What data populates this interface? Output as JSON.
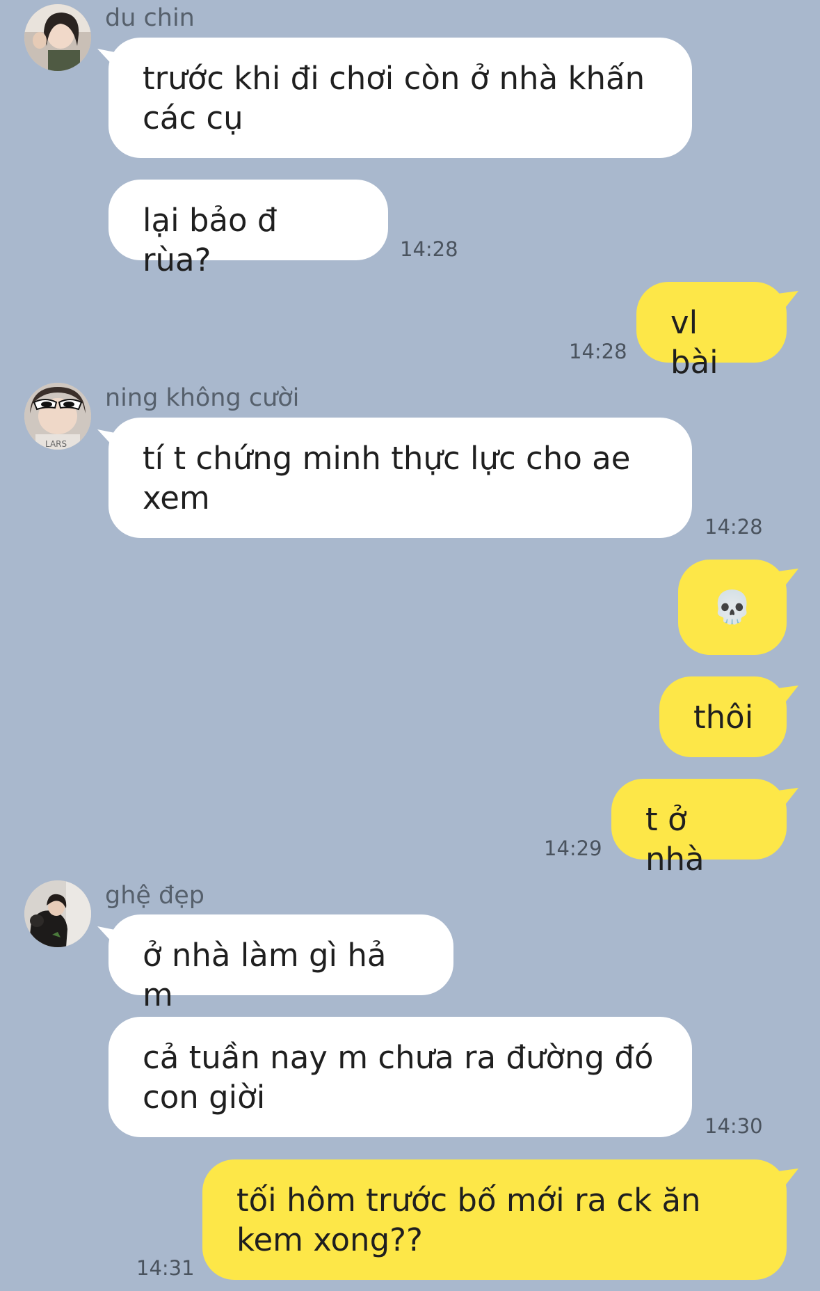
{
  "colors": {
    "background": "#a9b8cd",
    "incoming_bubble": "#ffffff",
    "outgoing_bubble": "#fde748",
    "timestamp": "#4a535e",
    "sender_name": "#56606c"
  },
  "messages": [
    {
      "id": 1,
      "sender": "du chin",
      "direction": "incoming",
      "text": "trước khi đi chơi còn ở nhà khấn các cụ"
    },
    {
      "id": 2,
      "sender": "du chin",
      "direction": "incoming",
      "text": "lại bảo đ rùa?",
      "time": "14:28"
    },
    {
      "id": 3,
      "sender": "me",
      "direction": "outgoing",
      "text": "vl bài",
      "time": "14:28"
    },
    {
      "id": 4,
      "sender": "ning không cười",
      "direction": "incoming",
      "text": "tí t chứng minh thực lực cho ae xem",
      "time": "14:28"
    },
    {
      "id": 5,
      "sender": "me",
      "direction": "outgoing",
      "text": "💀",
      "icon": "skull-emoji"
    },
    {
      "id": 6,
      "sender": "me",
      "direction": "outgoing",
      "text": "thôi"
    },
    {
      "id": 7,
      "sender": "me",
      "direction": "outgoing",
      "text": "t ở nhà",
      "time": "14:29"
    },
    {
      "id": 8,
      "sender": "ghệ đẹp",
      "direction": "incoming",
      "text": "ở nhà làm gì hả m"
    },
    {
      "id": 9,
      "sender": "ghệ đẹp",
      "direction": "incoming",
      "text": "cả tuần nay m chưa ra đường đó con giời",
      "time": "14:30"
    },
    {
      "id": 10,
      "sender": "me",
      "direction": "outgoing",
      "text": "tối hôm trước bố mới ra ck ăn kem xong??",
      "time": "14:31"
    }
  ],
  "senders": {
    "du_chin": "du chin",
    "ning": "ning không cười",
    "ghe_dep": "ghệ đẹp"
  }
}
